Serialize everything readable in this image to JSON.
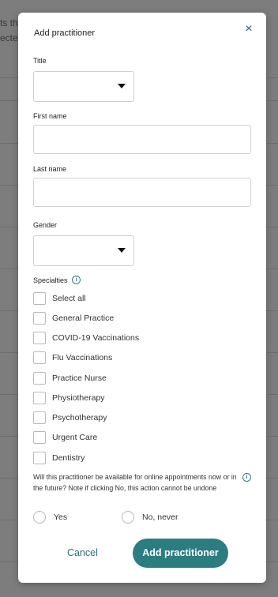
{
  "background": {
    "line1": "ts th",
    "line2": "ecte"
  },
  "modal": {
    "title": "Add practitioner",
    "close_glyph": "×"
  },
  "form": {
    "title_label": "Title",
    "title_value": "",
    "first_name_label": "First name",
    "first_name_value": "",
    "last_name_label": "Last name",
    "last_name_value": "",
    "gender_label": "Gender",
    "gender_value": "",
    "specialties_label": "Specialties",
    "specialties": [
      {
        "label": "Select all",
        "checked": false
      },
      {
        "label": "General Practice",
        "checked": false
      },
      {
        "label": "COVID-19 Vaccinations",
        "checked": false
      },
      {
        "label": "Flu Vaccinations",
        "checked": false
      },
      {
        "label": "Practice Nurse",
        "checked": false
      },
      {
        "label": "Physiotherapy",
        "checked": false
      },
      {
        "label": "Psychotherapy",
        "checked": false
      },
      {
        "label": "Urgent Care",
        "checked": false
      },
      {
        "label": "Dentistry",
        "checked": false
      }
    ],
    "online_question": "Will this practitioner be available for online appointments now or in the future? Note if clicking No, this action cannot be undone",
    "options": {
      "yes": "Yes",
      "no": "No, never"
    }
  },
  "actions": {
    "cancel": "Cancel",
    "submit": "Add practitioner"
  },
  "colors": {
    "accent": "#2b7d82",
    "overlay": "#7f7f7f"
  },
  "icons": {
    "info": "info-icon",
    "close": "close-icon",
    "caret": "chevron-down-icon"
  }
}
